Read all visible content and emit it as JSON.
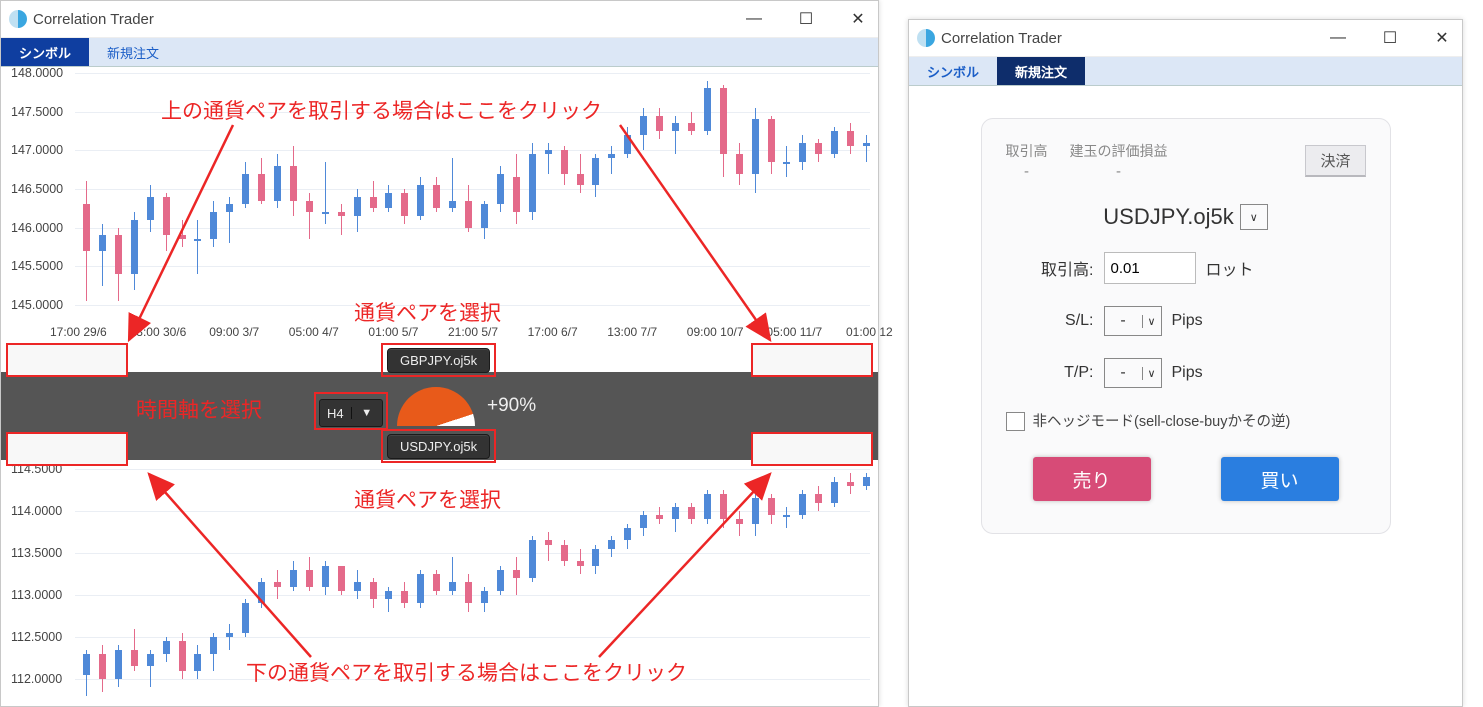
{
  "app_title": "Correlation Trader",
  "win_btns": {
    "min": "—",
    "max": "☐",
    "close": "✕"
  },
  "tabs": {
    "symbol": "シンボル",
    "neworder": "新規注文"
  },
  "pairs": {
    "top": "GBPJPY.oj5k",
    "bottom": "USDJPY.oj5k"
  },
  "timeframe": "H4",
  "correlation": "+90%",
  "axis1": [
    "148.0000",
    "147.5000",
    "147.0000",
    "146.5000",
    "146.0000",
    "145.5000",
    "145.0000"
  ],
  "axis1x": [
    "17:00 29/6",
    "13:00 30/6",
    "09:00 3/7",
    "05:00 4/7",
    "01:00 5/7",
    "21:00 5/7",
    "17:00 6/7",
    "13:00 7/7",
    "09:00 10/7",
    "05:00 11/7",
    "01:00 12"
  ],
  "axis2": [
    "114.5000",
    "114.0000",
    "113.5000",
    "113.0000",
    "112.5000",
    "112.0000"
  ],
  "annotations": {
    "top": "上の通貨ペアを取引する場合はここをクリック",
    "pairsel": "通貨ペアを選択",
    "timesel": "時間軸を選択",
    "bottom": "下の通貨ペアを取引する場合はここをクリック"
  },
  "order": {
    "vol_label": "取引高",
    "pl_label": "建玉の評価損益",
    "dash": "-",
    "settle": "決済",
    "symbol": "USDJPY.oj5k",
    "r_vol": "取引高:",
    "r_vol_v": "0.01",
    "r_vol_u": "ロット",
    "r_sl": "S/L:",
    "r_tp": "T/P:",
    "sel_dash": "-",
    "pips": "Pips",
    "hedge": "非ヘッジモード(sell-close-buyかその逆)",
    "sell": "売り",
    "buy": "買い"
  },
  "chart_data": [
    {
      "type": "candlestick",
      "symbol": "GBPJPY.oj5k",
      "ylim": [
        145.0,
        148.0
      ],
      "candles": [
        {
          "o": 146.3,
          "h": 146.6,
          "l": 145.05,
          "c": 145.7
        },
        {
          "o": 145.7,
          "h": 146.05,
          "l": 145.25,
          "c": 145.9
        },
        {
          "o": 145.9,
          "h": 146.0,
          "l": 145.05,
          "c": 145.4
        },
        {
          "o": 145.4,
          "h": 146.2,
          "l": 145.2,
          "c": 146.1
        },
        {
          "o": 146.1,
          "h": 146.55,
          "l": 145.95,
          "c": 146.4
        },
        {
          "o": 146.4,
          "h": 146.45,
          "l": 145.7,
          "c": 145.9
        },
        {
          "o": 145.9,
          "h": 146.1,
          "l": 145.75,
          "c": 145.85
        },
        {
          "o": 145.85,
          "h": 146.1,
          "l": 145.4,
          "c": 145.85
        },
        {
          "o": 145.85,
          "h": 146.35,
          "l": 145.75,
          "c": 146.2
        },
        {
          "o": 146.2,
          "h": 146.4,
          "l": 145.8,
          "c": 146.3
        },
        {
          "o": 146.3,
          "h": 146.85,
          "l": 146.25,
          "c": 146.7
        },
        {
          "o": 146.7,
          "h": 146.9,
          "l": 146.3,
          "c": 146.35
        },
        {
          "o": 146.35,
          "h": 146.95,
          "l": 146.25,
          "c": 146.8
        },
        {
          "o": 146.8,
          "h": 147.05,
          "l": 146.15,
          "c": 146.35
        },
        {
          "o": 146.35,
          "h": 146.45,
          "l": 145.85,
          "c": 146.2
        },
        {
          "o": 146.2,
          "h": 146.85,
          "l": 146.05,
          "c": 146.2
        },
        {
          "o": 146.2,
          "h": 146.3,
          "l": 145.9,
          "c": 146.15
        },
        {
          "o": 146.15,
          "h": 146.5,
          "l": 145.95,
          "c": 146.4
        },
        {
          "o": 146.4,
          "h": 146.6,
          "l": 146.2,
          "c": 146.25
        },
        {
          "o": 146.25,
          "h": 146.55,
          "l": 146.2,
          "c": 146.45
        },
        {
          "o": 146.45,
          "h": 146.5,
          "l": 146.05,
          "c": 146.15
        },
        {
          "o": 146.15,
          "h": 146.65,
          "l": 146.1,
          "c": 146.55
        },
        {
          "o": 146.55,
          "h": 146.65,
          "l": 146.2,
          "c": 146.25
        },
        {
          "o": 146.25,
          "h": 146.9,
          "l": 146.2,
          "c": 146.35
        },
        {
          "o": 146.35,
          "h": 146.55,
          "l": 145.95,
          "c": 146.0
        },
        {
          "o": 146.0,
          "h": 146.35,
          "l": 145.85,
          "c": 146.3
        },
        {
          "o": 146.3,
          "h": 146.8,
          "l": 146.2,
          "c": 146.7
        },
        {
          "o": 146.65,
          "h": 146.95,
          "l": 146.05,
          "c": 146.2
        },
        {
          "o": 146.2,
          "h": 147.1,
          "l": 146.1,
          "c": 146.95
        },
        {
          "o": 146.95,
          "h": 147.1,
          "l": 146.7,
          "c": 147.0
        },
        {
          "o": 147.0,
          "h": 147.05,
          "l": 146.55,
          "c": 146.7
        },
        {
          "o": 146.7,
          "h": 146.95,
          "l": 146.45,
          "c": 146.55
        },
        {
          "o": 146.55,
          "h": 146.95,
          "l": 146.4,
          "c": 146.9
        },
        {
          "o": 146.9,
          "h": 147.05,
          "l": 146.7,
          "c": 146.95
        },
        {
          "o": 146.95,
          "h": 147.3,
          "l": 146.9,
          "c": 147.2
        },
        {
          "o": 147.2,
          "h": 147.55,
          "l": 147.0,
          "c": 147.45
        },
        {
          "o": 147.45,
          "h": 147.55,
          "l": 147.15,
          "c": 147.25
        },
        {
          "o": 147.25,
          "h": 147.45,
          "l": 146.95,
          "c": 147.35
        },
        {
          "o": 147.35,
          "h": 147.5,
          "l": 147.2,
          "c": 147.25
        },
        {
          "o": 147.25,
          "h": 147.9,
          "l": 147.2,
          "c": 147.8
        },
        {
          "o": 147.8,
          "h": 147.85,
          "l": 146.65,
          "c": 146.95
        },
        {
          "o": 146.95,
          "h": 147.1,
          "l": 146.55,
          "c": 146.7
        },
        {
          "o": 146.7,
          "h": 147.55,
          "l": 146.45,
          "c": 147.4
        },
        {
          "o": 147.4,
          "h": 147.45,
          "l": 146.7,
          "c": 146.85
        },
        {
          "o": 146.85,
          "h": 147.05,
          "l": 146.65,
          "c": 146.85
        },
        {
          "o": 146.85,
          "h": 147.2,
          "l": 146.75,
          "c": 147.1
        },
        {
          "o": 147.1,
          "h": 147.15,
          "l": 146.85,
          "c": 146.95
        },
        {
          "o": 146.95,
          "h": 147.3,
          "l": 146.9,
          "c": 147.25
        },
        {
          "o": 147.25,
          "h": 147.35,
          "l": 146.95,
          "c": 147.05
        },
        {
          "o": 147.05,
          "h": 147.2,
          "l": 146.85,
          "c": 147.1
        }
      ]
    },
    {
      "type": "candlestick",
      "symbol": "USDJPY.oj5k",
      "ylim": [
        112.0,
        114.5
      ],
      "candles": [
        {
          "o": 112.05,
          "h": 112.35,
          "l": 111.8,
          "c": 112.3
        },
        {
          "o": 112.3,
          "h": 112.4,
          "l": 111.85,
          "c": 112.0
        },
        {
          "o": 112.0,
          "h": 112.4,
          "l": 111.9,
          "c": 112.35
        },
        {
          "o": 112.35,
          "h": 112.6,
          "l": 112.1,
          "c": 112.15
        },
        {
          "o": 112.15,
          "h": 112.35,
          "l": 111.9,
          "c": 112.3
        },
        {
          "o": 112.3,
          "h": 112.5,
          "l": 112.2,
          "c": 112.45
        },
        {
          "o": 112.45,
          "h": 112.55,
          "l": 112.0,
          "c": 112.1
        },
        {
          "o": 112.1,
          "h": 112.4,
          "l": 112.0,
          "c": 112.3
        },
        {
          "o": 112.3,
          "h": 112.55,
          "l": 112.1,
          "c": 112.5
        },
        {
          "o": 112.5,
          "h": 112.65,
          "l": 112.35,
          "c": 112.55
        },
        {
          "o": 112.55,
          "h": 112.95,
          "l": 112.5,
          "c": 112.9
        },
        {
          "o": 112.9,
          "h": 113.2,
          "l": 112.85,
          "c": 113.15
        },
        {
          "o": 113.15,
          "h": 113.3,
          "l": 112.95,
          "c": 113.1
        },
        {
          "o": 113.1,
          "h": 113.4,
          "l": 113.05,
          "c": 113.3
        },
        {
          "o": 113.3,
          "h": 113.45,
          "l": 113.05,
          "c": 113.1
        },
        {
          "o": 113.1,
          "h": 113.4,
          "l": 113.0,
          "c": 113.35
        },
        {
          "o": 113.35,
          "h": 113.35,
          "l": 113.0,
          "c": 113.05
        },
        {
          "o": 113.05,
          "h": 113.3,
          "l": 112.95,
          "c": 113.15
        },
        {
          "o": 113.15,
          "h": 113.2,
          "l": 112.85,
          "c": 112.95
        },
        {
          "o": 112.95,
          "h": 113.1,
          "l": 112.8,
          "c": 113.05
        },
        {
          "o": 113.05,
          "h": 113.15,
          "l": 112.85,
          "c": 112.9
        },
        {
          "o": 112.9,
          "h": 113.3,
          "l": 112.85,
          "c": 113.25
        },
        {
          "o": 113.25,
          "h": 113.3,
          "l": 113.0,
          "c": 113.05
        },
        {
          "o": 113.05,
          "h": 113.45,
          "l": 113.0,
          "c": 113.15
        },
        {
          "o": 113.15,
          "h": 113.25,
          "l": 112.8,
          "c": 112.9
        },
        {
          "o": 112.9,
          "h": 113.1,
          "l": 112.8,
          "c": 113.05
        },
        {
          "o": 113.05,
          "h": 113.35,
          "l": 113.0,
          "c": 113.3
        },
        {
          "o": 113.3,
          "h": 113.45,
          "l": 113.0,
          "c": 113.2
        },
        {
          "o": 113.2,
          "h": 113.7,
          "l": 113.15,
          "c": 113.65
        },
        {
          "o": 113.65,
          "h": 113.75,
          "l": 113.4,
          "c": 113.6
        },
        {
          "o": 113.6,
          "h": 113.65,
          "l": 113.35,
          "c": 113.4
        },
        {
          "o": 113.4,
          "h": 113.55,
          "l": 113.25,
          "c": 113.35
        },
        {
          "o": 113.35,
          "h": 113.6,
          "l": 113.25,
          "c": 113.55
        },
        {
          "o": 113.55,
          "h": 113.7,
          "l": 113.45,
          "c": 113.65
        },
        {
          "o": 113.65,
          "h": 113.85,
          "l": 113.55,
          "c": 113.8
        },
        {
          "o": 113.8,
          "h": 114.0,
          "l": 113.7,
          "c": 113.95
        },
        {
          "o": 113.95,
          "h": 114.05,
          "l": 113.85,
          "c": 113.9
        },
        {
          "o": 113.9,
          "h": 114.1,
          "l": 113.75,
          "c": 114.05
        },
        {
          "o": 114.05,
          "h": 114.1,
          "l": 113.85,
          "c": 113.9
        },
        {
          "o": 113.9,
          "h": 114.25,
          "l": 113.85,
          "c": 114.2
        },
        {
          "o": 114.2,
          "h": 114.25,
          "l": 113.8,
          "c": 113.9
        },
        {
          "o": 113.9,
          "h": 114.0,
          "l": 113.7,
          "c": 113.85
        },
        {
          "o": 113.85,
          "h": 114.2,
          "l": 113.7,
          "c": 114.15
        },
        {
          "o": 114.15,
          "h": 114.2,
          "l": 113.85,
          "c": 113.95
        },
        {
          "o": 113.95,
          "h": 114.05,
          "l": 113.8,
          "c": 113.95
        },
        {
          "o": 113.95,
          "h": 114.25,
          "l": 113.9,
          "c": 114.2
        },
        {
          "o": 114.2,
          "h": 114.3,
          "l": 114.0,
          "c": 114.1
        },
        {
          "o": 114.1,
          "h": 114.4,
          "l": 114.05,
          "c": 114.35
        },
        {
          "o": 114.35,
          "h": 114.45,
          "l": 114.2,
          "c": 114.3
        },
        {
          "o": 114.3,
          "h": 114.45,
          "l": 114.25,
          "c": 114.4
        }
      ]
    }
  ]
}
